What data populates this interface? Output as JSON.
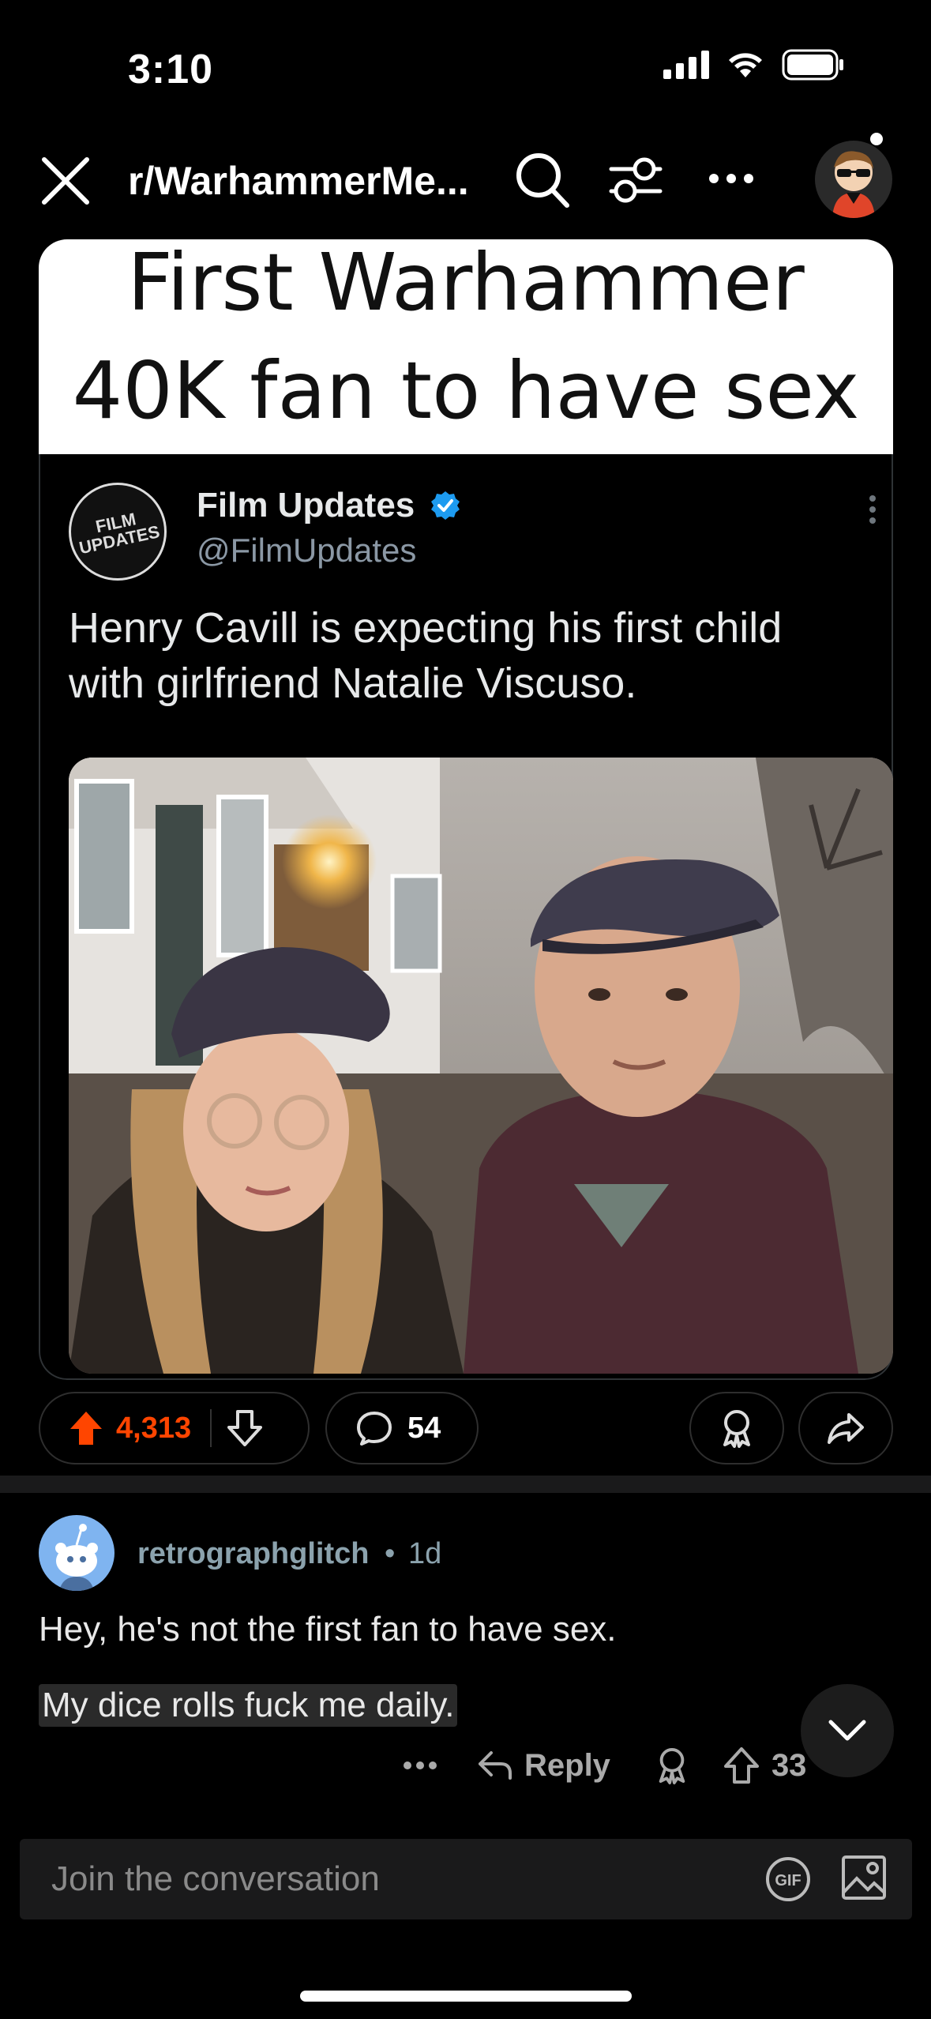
{
  "status_bar": {
    "time": "3:10"
  },
  "nav": {
    "title": "r/WarhammerMe...",
    "icons": [
      "close-icon",
      "search-icon",
      "filter-icon",
      "more-icon",
      "user-avatar"
    ]
  },
  "post": {
    "meme_caption_line1": "First Warhammer",
    "meme_caption_line2": "40K fan to have sex",
    "tweet": {
      "logo_text": "FILM UPDATES",
      "author_name": "Film Updates",
      "author_handle": "@FilmUpdates",
      "text": "Henry Cavill is expecting his first child with girlfriend Natalie Viscuso."
    },
    "actions": {
      "upvotes": "4,313",
      "comments": "54"
    }
  },
  "comment": {
    "username": "retrographglitch",
    "separator": "•",
    "age": "1d",
    "line1": "Hey, he's not the first fan to have sex.",
    "line2": "My dice rolls fuck me daily.",
    "reply_label": "Reply",
    "score": "33"
  },
  "composer": {
    "placeholder": "Join the conversation",
    "gif_label": "GIF"
  },
  "colors": {
    "upvote": "#ff4500",
    "verified": "#1d9bf0",
    "background": "#000000",
    "muted": "#8ba2ad"
  }
}
